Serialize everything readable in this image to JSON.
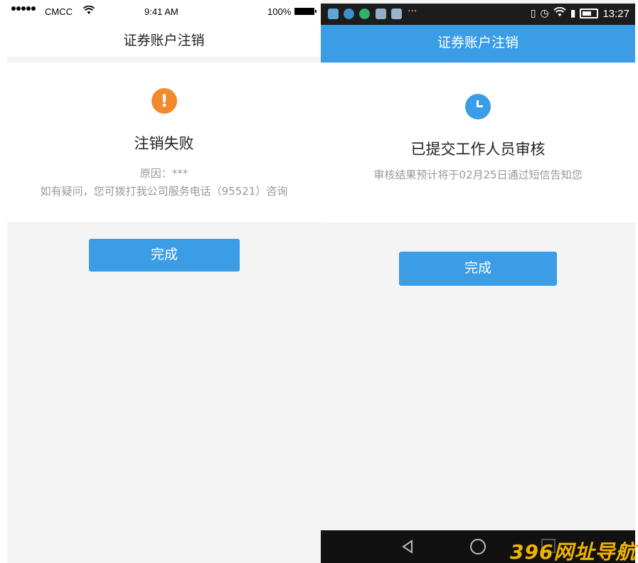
{
  "left_phone": {
    "status_bar": {
      "carrier": "CMCC",
      "time": "9:41 AM",
      "battery": "100%"
    },
    "nav_title": "证券账户注销",
    "icon": "exclamation-icon",
    "result_title": "注销失败",
    "reason": "原因：***",
    "contact_note": "如有疑问，您可拨打我公司服务电话（95521）咨询",
    "button_label": "完成"
  },
  "right_phone": {
    "status_bar": {
      "overflow": "···",
      "time": "13:27"
    },
    "nav_title": "证券账户注销",
    "icon": "clock-icon",
    "result_title": "已提交工作人员审核",
    "review_note": "审核结果预计将于02月25日通过短信告知您",
    "button_label": "完成"
  },
  "watermark": "396网址导航",
  "colors": {
    "accent_blue": "#3a9de5",
    "warning_orange": "#f08a2b",
    "background_gray": "#f4f4f4",
    "muted_text": "#999999"
  }
}
